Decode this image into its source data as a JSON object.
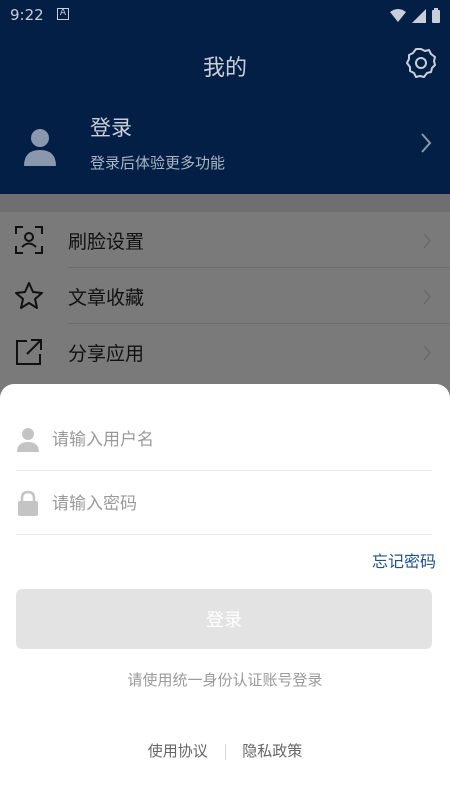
{
  "status_bar": {
    "time": "9:22",
    "notif_letter": "A"
  },
  "header": {
    "title": "我的",
    "login_title": "登录",
    "login_subtitle": "登录后体验更多功能"
  },
  "menu": {
    "items": [
      {
        "label": "刷脸设置",
        "icon": "face-scan-icon"
      },
      {
        "label": "文章收藏",
        "icon": "star-icon"
      },
      {
        "label": "分享应用",
        "icon": "share-icon"
      }
    ]
  },
  "login_sheet": {
    "username_placeholder": "请输入用户名",
    "password_placeholder": "请输入密码",
    "forgot_label": "忘记密码",
    "login_button_label": "登录",
    "hint": "请使用统一身份认证账号登录",
    "terms_link": "使用协议",
    "privacy_link": "隐私政策"
  },
  "colors": {
    "header_bg": "#041f45",
    "link_blue": "#1e4f8f",
    "button_disabled": "#e3e3e3"
  }
}
